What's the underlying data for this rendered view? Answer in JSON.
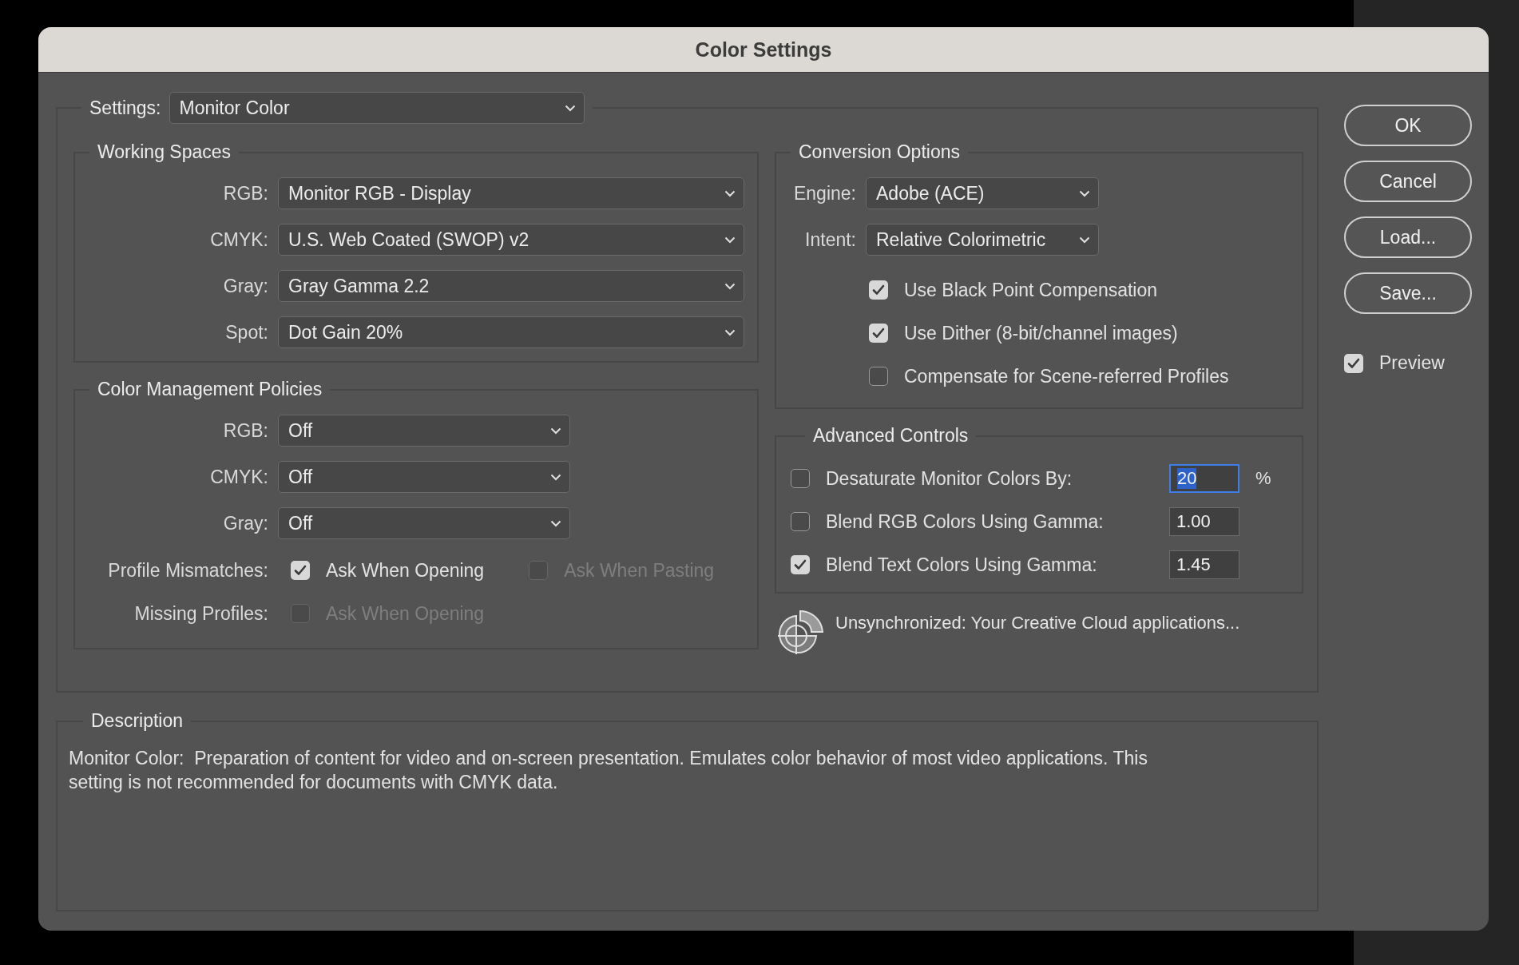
{
  "window": {
    "title": "Color Settings"
  },
  "settings": {
    "label": "Settings:",
    "value": "Monitor Color"
  },
  "working_spaces": {
    "title": "Working Spaces",
    "rows": [
      {
        "label": "RGB:",
        "value": "Monitor RGB - Display"
      },
      {
        "label": "CMYK:",
        "value": "U.S. Web Coated (SWOP) v2"
      },
      {
        "label": "Gray:",
        "value": "Gray Gamma 2.2"
      },
      {
        "label": "Spot:",
        "value": "Dot Gain 20%"
      }
    ]
  },
  "color_management_policies": {
    "title": "Color Management Policies",
    "rows": [
      {
        "label": "RGB:",
        "value": "Off"
      },
      {
        "label": "CMYK:",
        "value": "Off"
      },
      {
        "label": "Gray:",
        "value": "Off"
      }
    ],
    "option_rows": [
      {
        "label": "Profile Mismatches:",
        "options": [
          {
            "label": "Ask When Opening",
            "checked": true,
            "disabled": false
          },
          {
            "label": "Ask When Pasting",
            "checked": false,
            "disabled": true
          }
        ]
      },
      {
        "label": "Missing Profiles:",
        "options": [
          {
            "label": "Ask When Opening",
            "checked": false,
            "disabled": true
          }
        ]
      }
    ]
  },
  "conversion_options": {
    "title": "Conversion Options",
    "rows": [
      {
        "label": "Engine:",
        "value": "Adobe (ACE)"
      },
      {
        "label": "Intent:",
        "value": "Relative Colorimetric"
      }
    ],
    "options": [
      {
        "label": "Use Black Point Compensation",
        "checked": true
      },
      {
        "label": "Use Dither (8-bit/channel images)",
        "checked": true
      },
      {
        "label": "Compensate for Scene-referred Profiles",
        "checked": false
      }
    ]
  },
  "advanced_controls": {
    "title": "Advanced Controls",
    "rows": [
      {
        "label": "Desaturate Monitor Colors By:",
        "checked": false,
        "value": "20",
        "selected": true,
        "unit": "%"
      },
      {
        "label": "Blend RGB Colors Using Gamma:",
        "checked": false,
        "value": "1.00",
        "selected": false
      },
      {
        "label": "Blend Text Colors Using Gamma:",
        "checked": true,
        "value": "1.45",
        "selected": false
      }
    ]
  },
  "sync_status": "Unsynchronized: Your Creative Cloud applications...",
  "buttons": [
    "OK",
    "Cancel",
    "Load...",
    "Save..."
  ],
  "preview": {
    "label": "Preview",
    "checked": true
  },
  "description": {
    "title": "Description",
    "text": "Monitor Color:  Preparation of content for video and on-screen presentation. Emulates color behavior of most video applications. This setting is not recommended for documents with CMYK data."
  }
}
